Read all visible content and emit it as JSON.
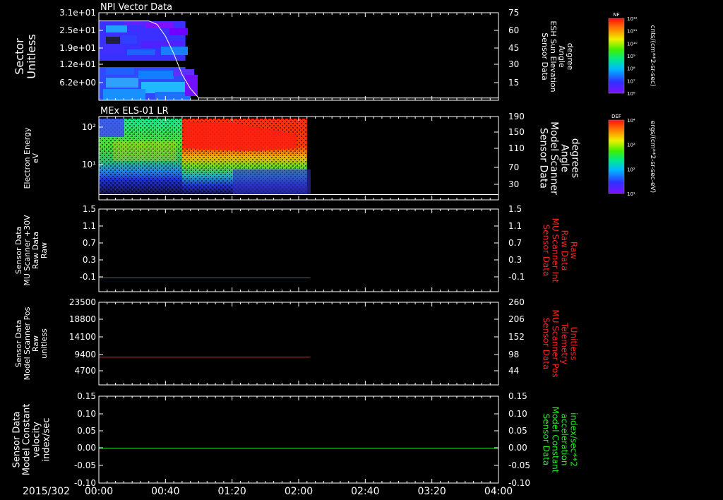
{
  "date_label": "2015/302",
  "time_ticks": [
    "00:00",
    "00:40",
    "01:20",
    "02:00",
    "02:40",
    "03:20",
    "04:00"
  ],
  "panels": [
    {
      "title": "NPI Vector Data",
      "left_label": [
        "Sector",
        "Unitless"
      ],
      "left_color": "#ffffff",
      "left_ticks": [
        "3.1e+01",
        "2.5e+01",
        "1.9e+01",
        "1.2e+01",
        "6.2e+00"
      ],
      "right_label": [
        "Sensor Data",
        "ESH Sun Elevation",
        "Angle",
        "degree"
      ],
      "right_color": "#ffffff",
      "right_ticks": [
        "75",
        "60",
        "45",
        "30",
        "15"
      ]
    },
    {
      "title": "MEx ELS-01 LR",
      "left_label": [
        "Electron Energy",
        "eV"
      ],
      "left_color": "#ffffff",
      "left_ticks": [
        "10²",
        "10¹"
      ],
      "right_label": [
        "Sensor Data",
        "Model Scanner",
        "Angle",
        "degrees"
      ],
      "right_color": "#ffffff",
      "right_ticks": [
        "190",
        "150",
        "110",
        "70",
        "30"
      ]
    },
    {
      "title": "",
      "left_label": [
        "Sensor Data",
        "MU Scanner +30V",
        "Raw Data",
        "Raw"
      ],
      "left_color": "#ffffff",
      "left_ticks": [
        "1.5",
        "1.1",
        "0.7",
        "0.3",
        "-0.1"
      ],
      "right_label": [
        "Sensor Data",
        "MU Scanner Int",
        "Raw Data",
        "Raw"
      ],
      "right_color": "#ff2020",
      "right_ticks": [
        "1.5",
        "1.1",
        "0.7",
        "0.3",
        "-0.1"
      ]
    },
    {
      "title": "",
      "left_label": [
        "Sensor Data",
        "Model Scanner Pos",
        "Raw",
        "unitless"
      ],
      "left_color": "#ffffff",
      "left_ticks": [
        "23500",
        "18800",
        "14100",
        "9400",
        "4700"
      ],
      "right_label": [
        "Sensor Data",
        "MU Scanner Pos",
        "Telemetry",
        "Unitless"
      ],
      "right_color": "#ff2020",
      "right_ticks": [
        "260",
        "206",
        "152",
        "98",
        "44"
      ]
    },
    {
      "title": "",
      "left_label": [
        "Sensor Data",
        "Model Constant",
        "velocity",
        "index/sec"
      ],
      "left_color": "#ffffff",
      "left_ticks": [
        "0.15",
        "0.10",
        "0.05",
        "0.00",
        "-0.05",
        "-0.10"
      ],
      "right_label": [
        "Sensor Data",
        "Model Constant",
        "acceleration",
        "index/sec**2"
      ],
      "right_color": "#22ee22",
      "right_ticks": [
        "0.15",
        "0.10",
        "0.05",
        "0.00",
        "-0.05",
        "-0.10"
      ]
    }
  ],
  "colorbars": [
    {
      "tag": "NF",
      "unit": "cnts/(cm**2-sr-sec)",
      "ticks": [
        "10¹²",
        "10¹¹",
        "10¹⁰",
        "10⁹",
        "10⁸",
        "10⁷",
        "10⁶"
      ]
    },
    {
      "tag": "DEF",
      "unit": "ergs/(cm**2-sr-sec-eV)",
      "ticks": [
        "10⁴",
        "10³",
        "10²",
        "10¹"
      ]
    }
  ],
  "chart_data": [
    {
      "type": "heatmap",
      "title": "NPI Vector Data",
      "ylabel": "Sector Unitless",
      "y2label": "Sensor Data ESH Sun Elevation Angle degree",
      "x_range": [
        "00:00",
        "04:00"
      ],
      "ylim": [
        0,
        31
      ],
      "y2lim": [
        0,
        75
      ],
      "data_extent": [
        "00:00",
        "00:52"
      ],
      "line_series": {
        "name": "",
        "color": "#ffffff",
        "x": [
          "00:00",
          "00:30",
          "00:35",
          "00:40",
          "00:45",
          "00:50",
          "00:55",
          "01:00",
          "04:00"
        ],
        "y": [
          68,
          68,
          65,
          55,
          40,
          22,
          10,
          2,
          2
        ]
      }
    },
    {
      "type": "heatmap",
      "title": "MEx ELS-01 LR",
      "ylabel": "Electron Energy eV",
      "y2label": "Sensor Data Model Scanner Angle degrees",
      "x_range": [
        "00:00",
        "04:00"
      ],
      "ylim": [
        1,
        200
      ],
      "yscale": "log",
      "y2lim": [
        0,
        190
      ],
      "data_extent": [
        "00:00",
        "02:05"
      ],
      "line_series": {
        "name": "",
        "color": "#ffffff",
        "x": [
          "00:00",
          "04:00"
        ],
        "y": [
          12,
          12
        ]
      }
    },
    {
      "type": "line",
      "ylabel": "Sensor Data MU Scanner +30V Raw Data Raw",
      "y2label": "Sensor Data MU Scanner Int Raw Data Raw",
      "ylim": [
        -0.3,
        1.5
      ],
      "series": [
        {
          "color": "#ff2020",
          "x": [
            "00:00",
            "02:07"
          ],
          "y": [
            0.0,
            0.0
          ]
        }
      ]
    },
    {
      "type": "line",
      "ylabel": "Sensor Data Model Scanner Pos Raw unitless",
      "y2label": "Sensor Data MU Scanner Pos Telemetry Unitless",
      "ylim": [
        0,
        23500
      ],
      "series": [
        {
          "color": "#ff2020",
          "x": [
            "00:00",
            "02:07"
          ],
          "y": [
            7900,
            7900
          ]
        }
      ]
    },
    {
      "type": "line",
      "ylabel": "Sensor Data Model Constant velocity index/sec",
      "y2label": "Sensor Data Model Constant acceleration index/sec**2",
      "ylim": [
        -0.1,
        0.15
      ],
      "series": [
        {
          "color": "#22ee22",
          "x": [
            "00:00",
            "04:00"
          ],
          "y": [
            0.0,
            0.0
          ]
        }
      ]
    }
  ]
}
